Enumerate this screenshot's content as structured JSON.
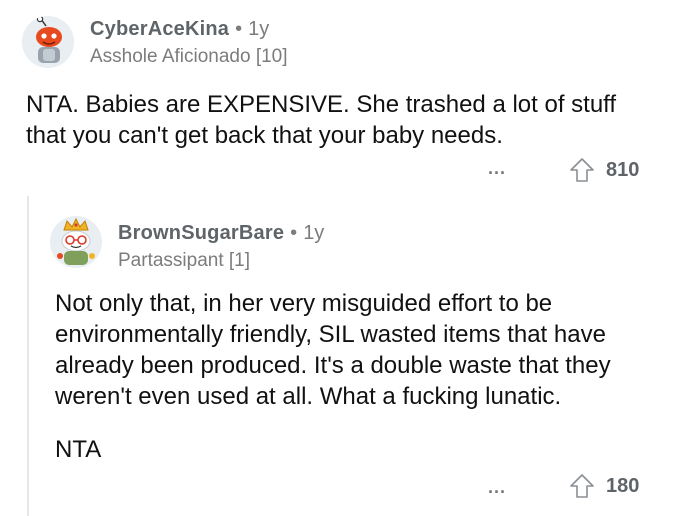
{
  "comment1": {
    "username": "CyberAceKina",
    "separator": "•",
    "age": "1y",
    "flair": "Asshole Aficionado [10]",
    "body_lines": [
      "NTA. Babies are EXPENSIVE. She trashed a lot of stuff",
      "that you can't get back that your baby needs."
    ],
    "more_label": "...",
    "upvotes": "810"
  },
  "comment2": {
    "username": "BrownSugarBare",
    "separator": "•",
    "age": "1y",
    "flair": "Partassipant [1]",
    "body_lines": [
      "Not only that, in her very misguided effort to be",
      "environmentally friendly, SIL wasted items that have",
      "already been produced. It's a double waste that they",
      "weren't even used at all. What a fucking lunatic."
    ],
    "verdict": "NTA",
    "more_label": "...",
    "upvotes": "180"
  },
  "icons": {
    "avatar1": "snoo-avatar-icon",
    "avatar2": "snoo-crown-avatar-icon",
    "upvote": "upvote-arrow-icon"
  },
  "colors": {
    "username": "#5f6469",
    "meta": "#7c7c7c",
    "thread_line": "#e4e6e8",
    "body": "#111111"
  }
}
